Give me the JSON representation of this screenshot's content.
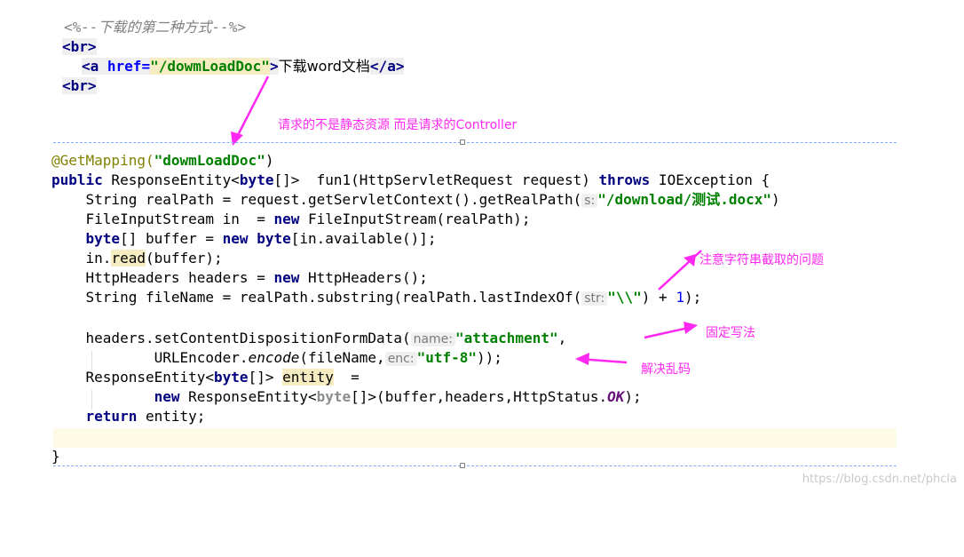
{
  "jsp": {
    "comment": "<%--下载的第二种方式--%>",
    "br1": "<br>",
    "a_open": "<a",
    "a_attr": "href=",
    "a_value": "\"/dowmLoadDoc\"",
    "a_close_gt": ">",
    "a_text": "下载word文档",
    "a_end_open": "</",
    "a_end_tag": "a",
    "a_end_gt": ">",
    "br2": "<br>"
  },
  "annotations": {
    "note_controller": "请求的不是静态资源 而是请求的Controller",
    "note_substring": "注意字符串截取的问题",
    "note_fixed": "固定写法",
    "note_encoding": "解决乱码"
  },
  "code": {
    "l1_ann": "@GetMapping(",
    "l1_str": "\"dowmLoadDoc\"",
    "l1_end": ")",
    "l2_public": "public",
    "l2_a": " ResponseEntity<",
    "l2_byte": "byte",
    "l2_b": "[]>  fun1(HttpServletRequest request) ",
    "l2_throws": "throws",
    "l2_c": " IOException {",
    "l3_a": "    String realPath = request.getServletContext().getRealPath(",
    "l3_hint": "s:",
    "l3_str": "\"/download/测试.docx\"",
    "l3_end": ")",
    "l4_a": "    FileInputStream in  = ",
    "l4_new": "new",
    "l4_b": " FileInputStream(realPath);",
    "l5_byte": "byte",
    "l5_a": "[] buffer = ",
    "l5_new": "new",
    "l5_byte2": "byte",
    "l5_b": "[in.available()];",
    "l6_a": "    in.",
    "l6_read": "read",
    "l6_b": "(buffer);",
    "l7_a": "    HttpHeaders headers = ",
    "l7_new": "new",
    "l7_b": " HttpHeaders();",
    "l8_a": "    String fileName = realPath.substring(realPath.lastIndexOf(",
    "l8_hint": "str:",
    "l8_str": "\"\\\\\"",
    "l8_b": ") + ",
    "l8_num": "1",
    "l8_c": ");",
    "l9_a": "    headers.setContentDispositionFormData(",
    "l9_hint": "name:",
    "l9_str": "\"attachment\"",
    "l9_b": ",",
    "l10_a": "            URLEncoder.",
    "l10_encode": "encode",
    "l10_b": "(fileName,",
    "l10_hint": "enc:",
    "l10_str": "\"utf-8\"",
    "l10_c": "));",
    "l11_a": "    ResponseEntity<",
    "l11_byte": "byte",
    "l11_b": "[]> ",
    "l11_entity": "entity",
    "l11_c": "  =",
    "l12_new": "new",
    "l12_a": " ResponseEntity<",
    "l12_byte": "byte",
    "l12_b": "[]>(buffer,headers,HttpStatus.",
    "l12_ok": "OK",
    "l12_c": ");",
    "l13_return": "return",
    "l13_a": " entity;",
    "l14_brace": "}"
  },
  "watermark": "https://blog.csdn.net/phcla",
  "colors": {
    "annotation_pink": "#ff28f0",
    "keyword": "#000080",
    "string": "#008000",
    "annotation": "#808000"
  }
}
